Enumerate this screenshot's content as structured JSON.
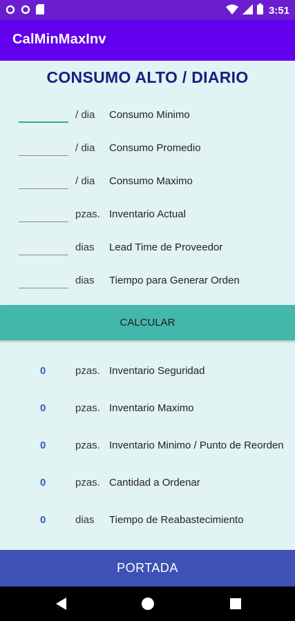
{
  "status_bar": {
    "time": "3:51"
  },
  "app": {
    "title": "CalMinMaxInv"
  },
  "page": {
    "title": "CONSUMO ALTO / DIARIO"
  },
  "inputs": [
    {
      "value": "",
      "unit": "/ dia",
      "label": "Consumo Minimo"
    },
    {
      "value": "",
      "unit": "/ dia",
      "label": "Consumo Promedio"
    },
    {
      "value": "",
      "unit": "/ dia",
      "label": "Consumo Maximo"
    },
    {
      "value": "",
      "unit": "pzas.",
      "label": "Inventario Actual"
    },
    {
      "value": "",
      "unit": "dias",
      "label": "Lead Time de Proveedor"
    },
    {
      "value": "",
      "unit": "dias",
      "label": "Tiempo para Generar Orden"
    }
  ],
  "calculate_label": "CALCULAR",
  "results": [
    {
      "value": "0",
      "unit": "pzas.",
      "label": "Inventario Seguridad"
    },
    {
      "value": "0",
      "unit": "pzas.",
      "label": "Inventario Maximo"
    },
    {
      "value": "0",
      "unit": "pzas.",
      "label": "Inventario Minimo / Punto de Reorden"
    },
    {
      "value": "0",
      "unit": "pzas.",
      "label": "Cantidad a Ordenar"
    },
    {
      "value": "0",
      "unit": "dias",
      "label": "Tiempo de Reabastecimiento"
    }
  ],
  "portada_label": "PORTADA",
  "colors": {
    "status_bar": "#6a1ed0",
    "app_bar": "#6200ee",
    "content_bg": "#e1f3f3",
    "title": "#14207e",
    "calc_button": "#44b7ab",
    "result_value": "#2f5fc0",
    "portada_button": "#3f51b5",
    "focus_underline": "#3aa796"
  },
  "icons": {
    "status_left": [
      "circle-notification-icon",
      "circle-notification-icon",
      "sd-card-icon"
    ],
    "status_right": [
      "wifi-icon",
      "signal-icon",
      "battery-icon"
    ],
    "nav": [
      "back-icon",
      "home-icon",
      "recents-icon"
    ]
  }
}
